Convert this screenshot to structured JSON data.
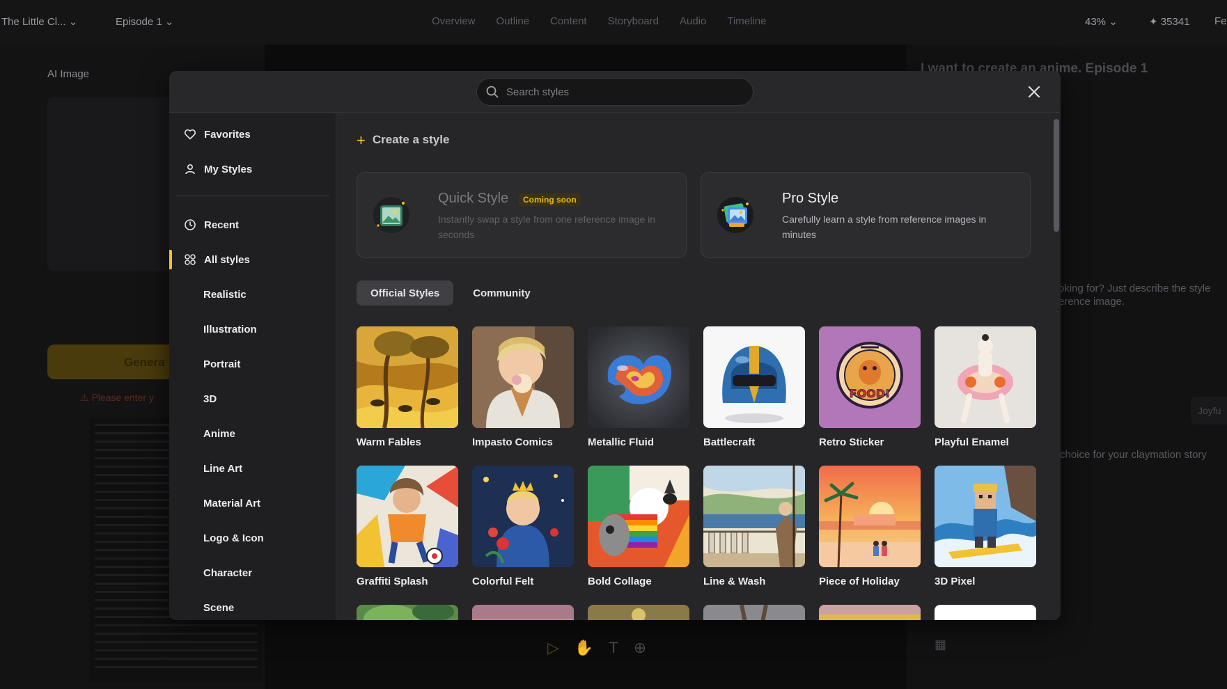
{
  "app": {
    "project_name": "The Little Cl...",
    "episode": "Episode 1",
    "nav": [
      "Overview",
      "Outline",
      "Content",
      "Storyboard",
      "Audio",
      "Timeline"
    ],
    "zoom": "43%",
    "credits": "35341",
    "right_edge": "Fe"
  },
  "left_panel": {
    "title": "AI Image",
    "generate_label": "Genera",
    "warning": "Please enter y"
  },
  "right_panel": {
    "title": "I want to create an anime. Episode 1",
    "hint": "oking for? Just describe the style erence image.",
    "note": "choice for your claymation story",
    "chip": "Joyfu"
  },
  "modal": {
    "search_placeholder": "Search styles",
    "sidebar": {
      "favorites": "Favorites",
      "my_styles": "My Styles",
      "recent": "Recent",
      "all_styles": "All styles",
      "categories": [
        "Realistic",
        "Illustration",
        "Portrait",
        "3D",
        "Anime",
        "Line Art",
        "Material Art",
        "Logo & Icon",
        "Character",
        "Scene"
      ]
    },
    "create_label": "Create a style",
    "quick_style": {
      "title": "Quick Style",
      "badge": "Coming soon",
      "desc": "Instantly swap a style from one reference image in seconds"
    },
    "pro_style": {
      "title": "Pro Style",
      "desc": "Carefully learn a style from reference images in minutes"
    },
    "tabs": [
      "Official Styles",
      "Community"
    ],
    "active_tab": "Official Styles",
    "styles": [
      "Warm Fables",
      "Impasto Comics",
      "Metallic Fluid",
      "Battlecraft",
      "Retro Sticker",
      "Playful Enamel",
      "Graffiti Splash",
      "Colorful Felt",
      "Bold Collage",
      "Line & Wash",
      "Piece of Holiday",
      "3D Pixel"
    ],
    "sticker_text": "FOOD!"
  },
  "colors": {
    "accent": "#f5c518",
    "modal_bg": "#262628",
    "sidebar_bg": "#1f1f21"
  }
}
